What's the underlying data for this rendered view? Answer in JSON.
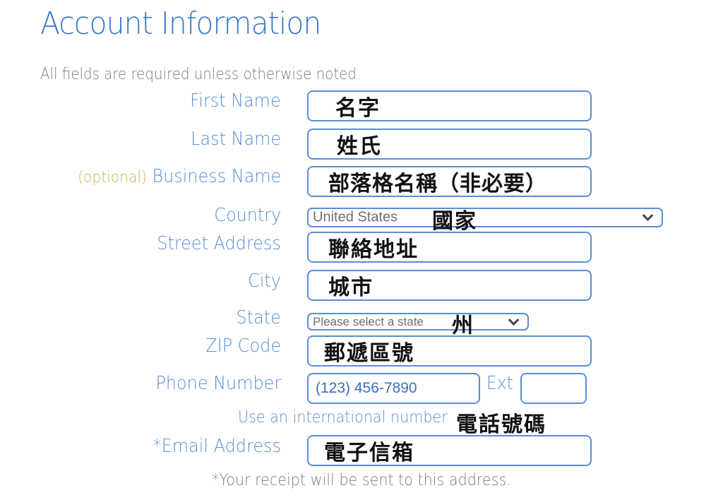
{
  "header": {
    "title": "Account Information",
    "note": "All fields are required unless otherwise noted."
  },
  "fields": {
    "first_name": {
      "label": "First Name",
      "value": "名字"
    },
    "last_name": {
      "label": "Last Name",
      "value": "姓氏"
    },
    "business_name": {
      "optional_tag": "(optional)",
      "label": "Business Name",
      "value": "部落格名稱（非必要）"
    },
    "country": {
      "label": "Country",
      "selected": "United States",
      "annotation": "國家"
    },
    "street_address": {
      "label": "Street Address",
      "value": "聯絡地址"
    },
    "city": {
      "label": "City",
      "value": "城市"
    },
    "state": {
      "label": "State",
      "selected": "Please select a state",
      "annotation": "州"
    },
    "zip_code": {
      "label": "ZIP Code",
      "value": "郵遞區號"
    },
    "phone_number": {
      "label": "Phone Number",
      "placeholder": "(123) 456-7890",
      "ext_label": "Ext",
      "ext_value": ""
    },
    "international": {
      "link": "Use an international number",
      "annotation": "電話號碼"
    },
    "email": {
      "label": "*Email Address",
      "value": "電子信箱",
      "note": "*Your receipt will be sent to this address."
    }
  },
  "colors": {
    "accent": "#3a78c9",
    "label": "#5b8ed1",
    "optional": "#c7b24a",
    "muted": "#7b7b7b"
  }
}
